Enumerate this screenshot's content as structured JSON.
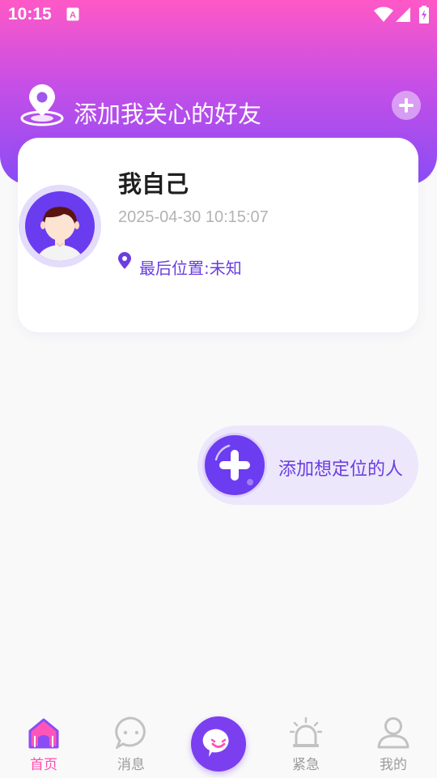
{
  "status_bar": {
    "time": "10:15",
    "icons": [
      "notification-a-icon",
      "wifi-icon",
      "signal-icon",
      "battery-charging-icon"
    ]
  },
  "header": {
    "title": "添加我关心的好友",
    "icons": [
      "location-pin-icon",
      "plus-icon"
    ]
  },
  "self_card": {
    "name": "我自己",
    "timestamp": "2025-04-30 10:15:07",
    "location": "最后位置:未知",
    "icons": [
      "avatar",
      "location-marker-icon"
    ]
  },
  "add_person": {
    "label": "添加想定位的人",
    "icon": "plus-icon"
  },
  "tabbar": {
    "items": [
      {
        "label": "首页",
        "icon": "home-icon",
        "active": true
      },
      {
        "label": "消息",
        "icon": "chat-bubble-icon",
        "active": false
      },
      {
        "label": "",
        "icon": "smile-bubble-icon",
        "active": false
      },
      {
        "label": "紧急",
        "icon": "alarm-siren-icon",
        "active": false
      },
      {
        "label": "我的",
        "icon": "user-icon",
        "active": false
      }
    ]
  },
  "colors": {
    "header_gradient_top": "#ff58c6",
    "header_gradient_bottom": "#8a4cf6",
    "accent_purple": "#6c3cf0",
    "active_tab": "#ff4fb0",
    "inactive_tab": "#9b9b9b",
    "pill_bg": "#ede7fc"
  }
}
